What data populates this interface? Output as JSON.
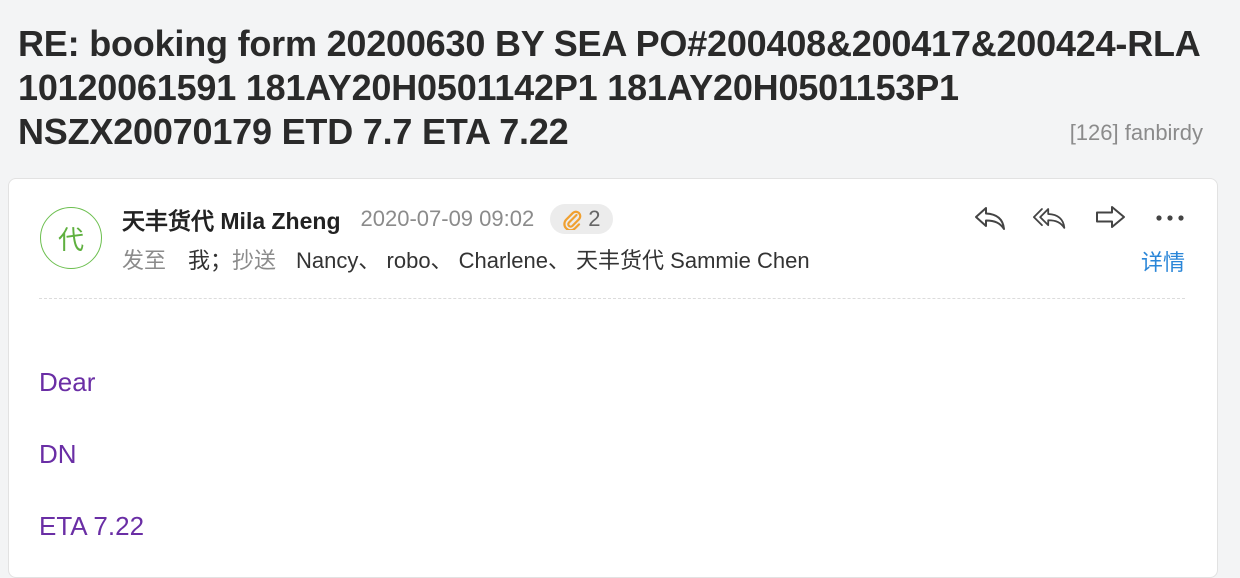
{
  "subject": "RE: booking form 20200630 BY SEA PO#200408&200417&200424-RLA 10120061591 181AY20H0501142P1 181AY20H0501153P1 NSZX20070179 ETD 7.7 ETA 7.22",
  "folder": "[126] fanbirdy",
  "message": {
    "avatar_char": "代",
    "sender": "天丰货代 Mila Zheng",
    "date": "2020-07-09 09:02",
    "attachment_count": "2",
    "to_label": "发至",
    "to_value": "我；",
    "cc_label": "抄送",
    "cc_list": "Nancy、 robo、 Charlene、 天丰货代 Sammie Chen",
    "details_label": "详情",
    "actions": [
      "reply-icon",
      "reply-all-icon",
      "forward-icon",
      "more-icon"
    ],
    "body": [
      "Dear",
      "DN",
      "ETA 7.22"
    ]
  },
  "colors": {
    "link": "#2a86d8",
    "body_text": "#6a2ea5",
    "avatar": "#5fb03f",
    "attachment_icon": "#f0a030"
  }
}
